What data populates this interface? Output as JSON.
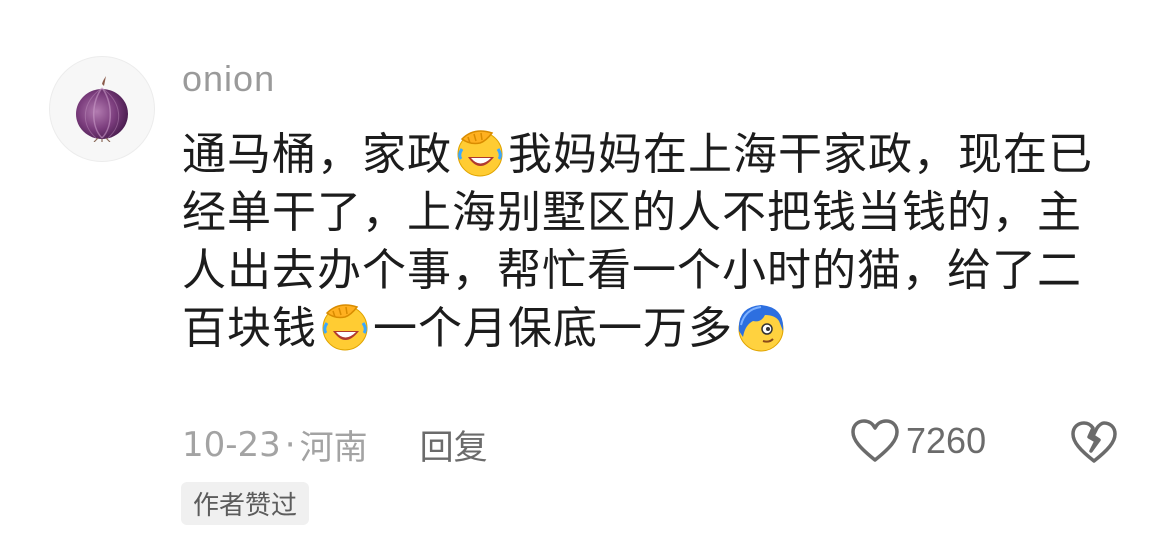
{
  "comment": {
    "username": "onion",
    "segments": [
      "通马桶，家政",
      "我妈妈在上海干家政，现在已经单干了，上海别墅区的人不把钱当钱的，主人出去办个事，帮忙看一个小时的猫，给了二百块钱",
      "一个月保底一万多"
    ],
    "emojis": [
      "facepalm-laugh-emoji",
      "facepalm-laugh-emoji",
      "blue-hair-smirk-emoji"
    ],
    "date": "10-23",
    "separator": "·",
    "location": "河南",
    "reply_label": "回复",
    "like_count": "7260",
    "author_liked_badge": "作者赞过"
  },
  "icons": {
    "avatar": "onion-avatar",
    "like": "heart-outline-icon",
    "dislike": "broken-heart-icon"
  },
  "colors": {
    "text_primary": "#1c1c1c",
    "text_secondary": "#a3a3a3",
    "badge_bg": "#f0f0f0"
  }
}
